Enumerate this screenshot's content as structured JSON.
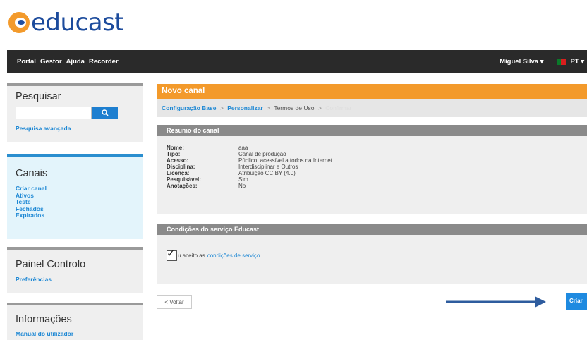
{
  "logo": {
    "text": "educast"
  },
  "nav": {
    "items": [
      "Portal",
      "Gestor",
      "Ajuda",
      "Recorder"
    ],
    "user": "Miguel Silva ▾",
    "language": "PT ▾"
  },
  "sidebar": {
    "search": {
      "title": "Pesquisar",
      "placeholder": "",
      "advanced": "Pesquisa avançada"
    },
    "canais": {
      "title": "Canais",
      "links": [
        "Criar canal",
        "Ativos",
        "Teste",
        "Fechados",
        "Expirados"
      ]
    },
    "painel": {
      "title": "Painel Controlo",
      "links": [
        "Preferências"
      ]
    },
    "info": {
      "title": "Informações",
      "links": [
        "Manual do utilizador"
      ]
    }
  },
  "main": {
    "title": "Novo canal",
    "breadcrumb": {
      "step1": "Configuração Base",
      "sep": ">",
      "step2": "Personalizar",
      "step3": "Termos de Uso",
      "step4": "Confirmar"
    },
    "summary": {
      "title": "Resumo do canal",
      "rows": [
        {
          "label": "Nome:",
          "value": "aaa"
        },
        {
          "label": "Tipo:",
          "value": "Canal de produção"
        },
        {
          "label": "Acesso:",
          "value": "Público: acessível a todos na Internet"
        },
        {
          "label": "Disciplina:",
          "value": "Interdisciplinar e Outros"
        },
        {
          "label": "Licença:",
          "value": "Atribuição CC BY (4.0)"
        },
        {
          "label": "Pesquisável:",
          "value": "Sim"
        },
        {
          "label": "Anotações:",
          "value": "No"
        }
      ]
    },
    "terms": {
      "title": "Condições do serviço Educast",
      "text": "u aceito as",
      "link": "condições de serviço",
      "checked": true
    },
    "buttons": {
      "back": "< Voltar",
      "create": "Criar"
    }
  },
  "colors": {
    "accent_orange": "#f39a2b",
    "link_blue": "#1e88d4",
    "button_blue": "#1e8ae0",
    "navbar": "#2a2a2a",
    "arrow": "#2e5c9e"
  }
}
